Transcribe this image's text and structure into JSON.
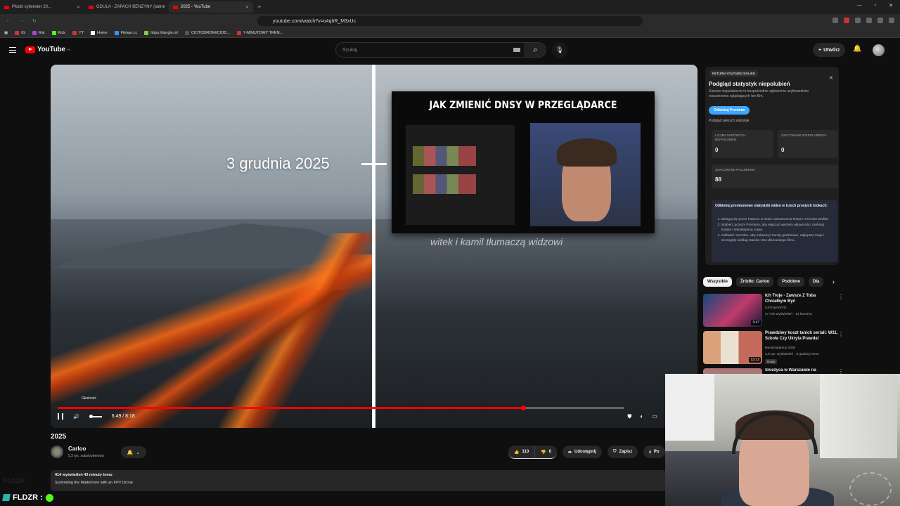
{
  "browser": {
    "tabs": [
      {
        "label": "Płocki sylwester 20..."
      },
      {
        "label": "GDULA - ZAPACH BENZYNY (ładne"
      },
      {
        "label": "2025 - YouTube"
      }
    ],
    "url": "youtube.com/watch?v=o4qhR_M3xUc",
    "bookmarks": [
      "IG",
      "Rat",
      "Kick",
      "YT",
      "Home",
      "Filman.cc",
      "https://tangle.io/",
      "CIOTODRON#CIOD...",
      "7-MINUTOWY TREN..."
    ]
  },
  "youtube": {
    "logo": "YouTube",
    "region": "PL",
    "search_placeholder": "Szukaj",
    "create_label": "Utwórz"
  },
  "player": {
    "overlay_date": "3 grudnia 2025",
    "thumb_title": "JAK ZMIENIĆ DNSY W PRZEGLĄDARCE",
    "caption": "witek i kamil tłumaczą widzowi",
    "volume_tooltip": "Głośność",
    "time": "6:49 / 8:18",
    "progress_fraction": 0.822
  },
  "video": {
    "title": "2025",
    "channel": "Carloo",
    "subscribers": "5,3 tys. subskrybentów",
    "likes": "110",
    "dislikes": "0",
    "share_label": "Udostępnij",
    "save_label": "Zapisz",
    "download_label": "Po",
    "meta": "414 wyświetleń  43 minuty temu",
    "desc_line": "Summiting the Matterhorn with an FPV Drone"
  },
  "rtd": {
    "badge": "RETURN YOUTUBE DISLIKE",
    "title": "Podgląd statystyk niepolubień",
    "desc": "Surowe niepolubienia to bezpośrednie zgłoszenia użytkowników rozszerzenia oglądających ten film.",
    "premium_btn": "Odblokuj Premium",
    "full_stats": "Podgląd pełnych statystyk",
    "raw_label": "LICZBA SUROWYCH NIEPOLUBIEŃ",
    "raw_value": "0",
    "est_dislike_label": "SZACOWANE NIEPOLUBIENIA",
    "est_dislike_value": "0",
    "est_like_label": "SZACOWANE POLUBIENIA",
    "est_like_value": "88",
    "info_heading": "Odblokuj premiumowe statystyki wideo w trzech prostych krokach:",
    "steps": [
      "Zaloguj się przez Patreon w oknie rozszerzenia Return YouTube Dislike.",
      "Wybierz poziom Premium, aby włączyć wykresy aktywności, rankingi krajów i interaktywną mapę.",
      "Odśwież YouTube, aby zobaczyć trendy godzinowe, najlepsze kraje i szczegóły według stanów USA dla każdego filmu."
    ]
  },
  "chips": [
    "Wszystkie",
    "Źródło: Carloo",
    "Podobne",
    "Dla"
  ],
  "recs": [
    {
      "title": "Ich Troje - Zawsze Z Toba Chciałbym Być",
      "channel": "IchTrojeVEVO",
      "meta": "47 mln wyświetleń · 13 lat temu",
      "duration": "3:47"
    },
    {
      "title": "Prawdziwy koszt tanich seriali: W11, Szkoła Czy Ukryta Prawda!",
      "channel": "Neostradamus 2000",
      "meta": "3,6 tys. wyświetleń · 3 godziny temu",
      "duration": "13:12",
      "badge": "Nowy"
    },
    {
      "title": "Śnieżyca w Warszawie na",
      "channel": "",
      "meta": "",
      "duration": ""
    }
  ],
  "overlay": {
    "streamer": "FLDZR :"
  },
  "colors": {
    "accent": "#ff0000",
    "premium": "#3ea6ff",
    "background": "#0f0f0f"
  }
}
